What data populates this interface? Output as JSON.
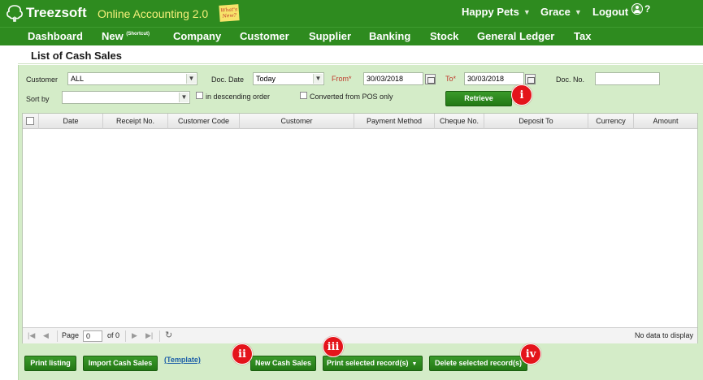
{
  "app": {
    "brand": "Treezsoft",
    "product": "Online Accounting 2.0",
    "whats_new": "What's New?",
    "company": "Happy Pets",
    "user": "Grace",
    "logout": "Logout",
    "help": "?"
  },
  "menu": {
    "items": [
      {
        "label": "Dashboard"
      },
      {
        "label": "New",
        "sup": "(Shortcut)"
      },
      {
        "label": "Company"
      },
      {
        "label": "Customer"
      },
      {
        "label": "Supplier"
      },
      {
        "label": "Banking"
      },
      {
        "label": "Stock"
      },
      {
        "label": "General Ledger"
      },
      {
        "label": "Tax"
      }
    ]
  },
  "page": {
    "title": "List of Cash Sales"
  },
  "filters": {
    "customer_label": "Customer",
    "customer_value": "ALL",
    "doc_date_label": "Doc. Date",
    "doc_date_value": "Today",
    "from_label": "From",
    "from_value": "30/03/2018",
    "to_label": "To",
    "to_value": "30/03/2018",
    "doc_no_label": "Doc. No.",
    "doc_no_value": "",
    "required_mark": "*",
    "sort_by_label": "Sort by",
    "sort_by_value": "",
    "descending_label": "in descending order",
    "pos_label": "Converted from POS only",
    "retrieve_label": "Retrieve"
  },
  "grid": {
    "columns": [
      "Date",
      "Receipt No.",
      "Customer Code",
      "Customer",
      "Payment Method",
      "Cheque No.",
      "Deposit To",
      "Currency",
      "Amount"
    ],
    "rows": [],
    "pager": {
      "page_label": "Page",
      "page_value": "0",
      "of_label": "of 0",
      "status": "No data to display"
    }
  },
  "footer": {
    "print_listing": "Print listing",
    "import_cash_sales": "Import Cash Sales",
    "template": "(Template)",
    "new_cash_sales": "New Cash Sales",
    "print_selected": "Print selected record(s)",
    "delete_selected": "Delete selected record(s)"
  },
  "annotations": {
    "badge_i": "i",
    "badge_ii": "ii",
    "badge_iii": "iii",
    "badge_iv": "iv"
  },
  "colors": {
    "brand_green": "#2e8b1f",
    "panel_green": "#d4ecc8",
    "badge_red": "#e4141b",
    "product_yellow": "#f5f07a",
    "required_red": "#c0392b"
  }
}
